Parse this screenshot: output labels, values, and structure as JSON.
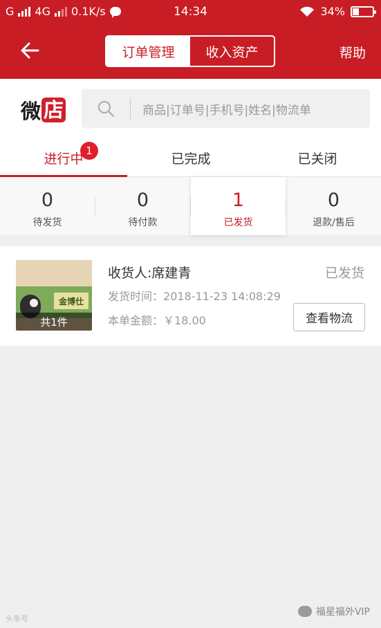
{
  "status_bar": {
    "carrier": "G",
    "network": "4G",
    "speed": "0.1K/s",
    "time": "14:34",
    "battery": "34%"
  },
  "header": {
    "tabs": [
      "订单管理",
      "收入资产"
    ],
    "help": "帮助"
  },
  "brand": {
    "wei": "微",
    "dian": "店"
  },
  "search": {
    "placeholder": "商品|订单号|手机号|姓名|物流单"
  },
  "tabs": [
    {
      "label": "进行中",
      "badge": "1"
    },
    {
      "label": "已完成"
    },
    {
      "label": "已关闭"
    }
  ],
  "stats": [
    {
      "value": "0",
      "label": "待发货"
    },
    {
      "value": "0",
      "label": "待付款"
    },
    {
      "value": "1",
      "label": "已发货"
    },
    {
      "value": "0",
      "label": "退款/售后"
    }
  ],
  "order": {
    "thumb_brand": "金博仕",
    "count": "共1件",
    "receiver": "收货人:席建青",
    "status": "已发货",
    "time_label": "发货时间：",
    "time_value": "2018-11-23 14:08:29",
    "amount_label": "本单金额：",
    "amount_value": "￥18.00",
    "logistics_button": "查看物流"
  },
  "watermarks": {
    "left": "头条号",
    "right": "福星福外VIP"
  },
  "colors": {
    "brand_red": "#c81d25",
    "badge_red": "#e11f2b",
    "background": "#efefef"
  }
}
